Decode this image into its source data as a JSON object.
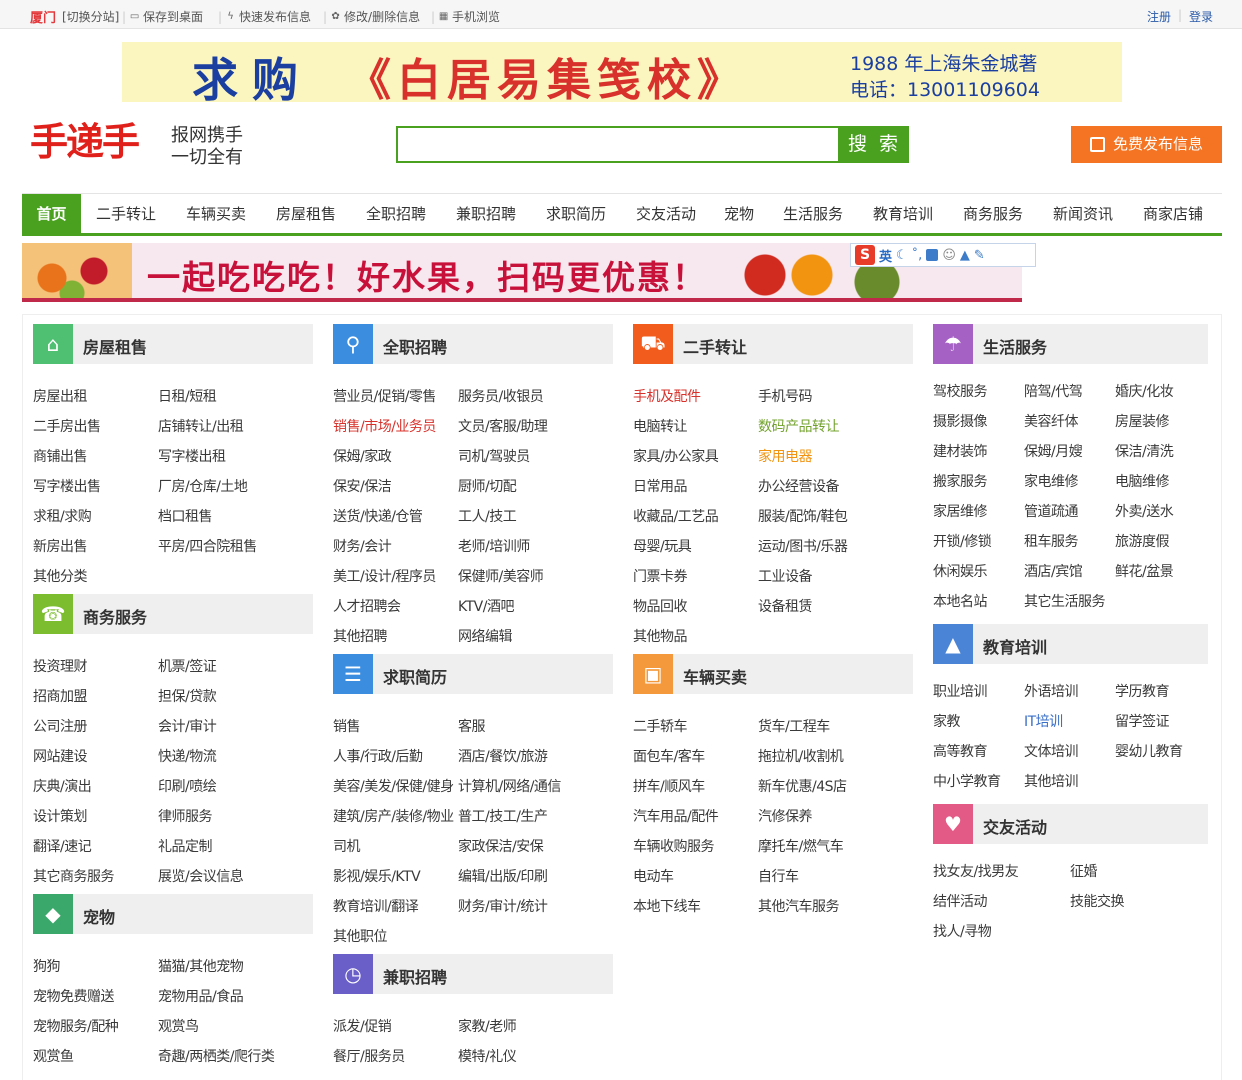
{
  "topbar": {
    "city": "厦门",
    "switch": "[切换分站]",
    "save_desktop": "保存到桌面",
    "quick_post": "快速发布信息",
    "edit_delete": "修改/删除信息",
    "mobile": "手机浏览",
    "register": "注册",
    "login": "登录"
  },
  "banner_top": {
    "buy": "求购",
    "title": "《白居易集笺校》",
    "info1": "1988 年上海朱金城著",
    "info2": "电话：13001109604"
  },
  "header": {
    "logo": "手递手",
    "slogan1": "报网携手",
    "slogan2": "一切全有",
    "search_value": "",
    "search_button": "搜 索",
    "post_button": "免费发布信息"
  },
  "nav": [
    "首页",
    "二手转让",
    "车辆买卖",
    "房屋租售",
    "全职招聘",
    "兼职招聘",
    "求职简历",
    "交友活动",
    "宠物",
    "生活服务",
    "教育培训",
    "商务服务",
    "新闻资讯",
    "商家店铺"
  ],
  "banner_fruit": {
    "slogan": "一起吃吃吃！好水果，扫码更优惠！"
  },
  "ime": {
    "lang": "英"
  },
  "colors": {
    "green": "#4aa120",
    "orange": "#f57423",
    "red": "#d8312b"
  },
  "categories": {
    "house": {
      "title": "房屋租售",
      "icon": "house-icon",
      "links": [
        "房屋出租",
        "日租/短租",
        "二手房出售",
        "店铺转让/出租",
        "商铺出售",
        "写字楼出租",
        "写字楼出售",
        "厂房/仓库/土地",
        "求租/求购",
        "档口租售",
        "新房出售",
        "平房/四合院租售",
        "其他分类"
      ]
    },
    "business": {
      "title": "商务服务",
      "icon": "phone-icon",
      "links": [
        "投资理财",
        "机票/签证",
        "招商加盟",
        "担保/贷款",
        "公司注册",
        "会计/审计",
        "网站建设",
        "快递/物流",
        "庆典/演出",
        "印刷/喷绘",
        "设计策划",
        "律师服务",
        "翻译/速记",
        "礼品定制",
        "其它商务服务",
        "展览/会议信息"
      ]
    },
    "pet": {
      "title": "宠物",
      "icon": "dog-icon",
      "links": [
        "狗狗",
        "猫猫/其他宠物",
        "宠物免费赠送",
        "宠物用品/食品",
        "宠物服务/配种",
        "观赏鸟",
        "观赏鱼",
        "奇趣/两栖类/爬行类"
      ]
    },
    "fulltime": {
      "title": "全职招聘",
      "icon": "person-icon",
      "links": [
        "营业员/促销/零售",
        "服务员/收银员",
        "销售/市场/业务员",
        "文员/客服/助理",
        "保姆/家政",
        "司机/驾驶员",
        "保安/保洁",
        "厨师/切配",
        "送货/快递/仓管",
        "工人/技工",
        "财务/会计",
        "老师/培训师",
        "美工/设计/程序员",
        "保健师/美容师",
        "人才招聘会",
        "KTV/酒吧",
        "其他招聘",
        "网络编辑"
      ]
    },
    "resume": {
      "title": "求职简历",
      "icon": "clipboard-icon",
      "links": [
        "销售",
        "客服",
        "人事/行政/后勤",
        "酒店/餐饮/旅游",
        "美容/美发/保健/健身",
        "计算机/网络/通信",
        "建筑/房产/装修/物业",
        "普工/技工/生产",
        "司机",
        "家政保洁/安保",
        "影视/娱乐/KTV",
        "编辑/出版/印刷",
        "教育培训/翻译",
        "财务/审计/统计",
        "其他职位"
      ]
    },
    "parttime": {
      "title": "兼职招聘",
      "icon": "clock-icon",
      "links": [
        "派发/促销",
        "家教/老师",
        "餐厅/服务员",
        "模特/礼仪"
      ]
    },
    "secondhand": {
      "title": "二手转让",
      "icon": "cart-icon",
      "links": [
        "手机及配件",
        "手机号码",
        "电脑转让",
        "数码产品转让",
        "家具/办公家具",
        "家用电器",
        "日常用品",
        "办公经营设备",
        "收藏品/工艺品",
        "服装/配饰/鞋包",
        "母婴/玩具",
        "运动/图书/乐器",
        "门票卡券",
        "工业设备",
        "物品回收",
        "设备租赁",
        "其他物品"
      ]
    },
    "vehicle": {
      "title": "车辆买卖",
      "icon": "car-icon",
      "links": [
        "二手轿车",
        "货车/工程车",
        "面包车/客车",
        "拖拉机/收割机",
        "拼车/顺风车",
        "新车优惠/4S店",
        "汽车用品/配件",
        "汽修保养",
        "车辆收购服务",
        "摩托车/燃气车",
        "电动车",
        "自行车",
        "本地下线车",
        "其他汽车服务"
      ]
    },
    "life": {
      "title": "生活服务",
      "icon": "umbrella-icon",
      "links": [
        "驾校服务",
        "陪驾/代驾",
        "婚庆/化妆",
        "摄影摄像",
        "美容纤体",
        "房屋装修",
        "建材装饰",
        "保姆/月嫂",
        "保洁/清洗",
        "搬家服务",
        "家电维修",
        "电脑维修",
        "家居维修",
        "管道疏通",
        "外卖/送水",
        "开锁/修锁",
        "租车服务",
        "旅游度假",
        "休闲娱乐",
        "酒店/宾馆",
        "鲜花/盆景",
        "本地名站",
        "其它生活服务"
      ]
    },
    "education": {
      "title": "教育培训",
      "icon": "graduation-cap-icon",
      "links": [
        "职业培训",
        "外语培训",
        "学历教育",
        "家教",
        "IT培训",
        "留学签证",
        "高等教育",
        "文体培训",
        "婴幼儿教育",
        "中小学教育",
        "其他培训"
      ]
    },
    "dating": {
      "title": "交友活动",
      "icon": "heart-icon",
      "links": [
        "找女友/找男友",
        "征婚",
        "结伴活动",
        "技能交换",
        "找人/寻物"
      ]
    }
  }
}
